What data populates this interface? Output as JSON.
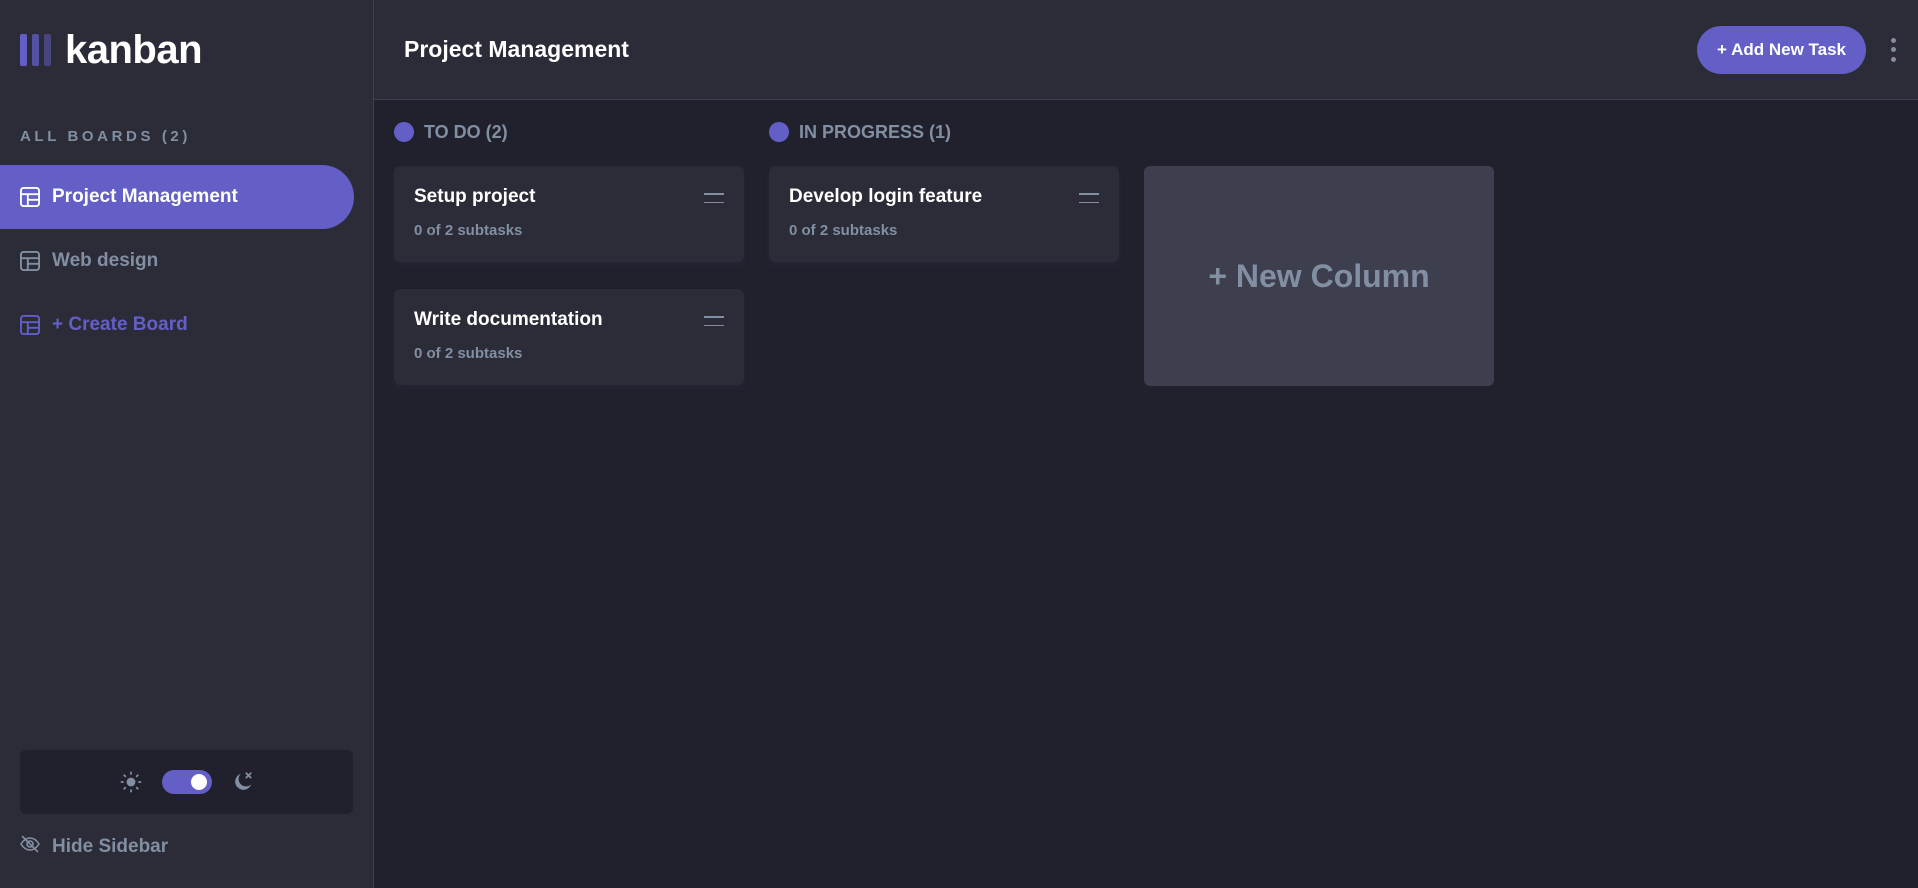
{
  "app": {
    "logo_text": "kanban",
    "accent_color": "#635fc7"
  },
  "sidebar": {
    "heading": "ALL BOARDS (2)",
    "boards": [
      {
        "label": "Project Management",
        "active": true,
        "icon": "board-icon"
      },
      {
        "label": "Web design",
        "active": false,
        "icon": "board-icon"
      }
    ],
    "create_label": "+ Create Board",
    "theme": {
      "light_icon": "sun-icon",
      "dark_icon": "moon-icon",
      "dark_mode": true
    },
    "hide_label": "Hide Sidebar"
  },
  "header": {
    "title": "Project Management",
    "add_task_label": "+ Add New Task",
    "menu_icon": "vertical-ellipsis-icon"
  },
  "columns": [
    {
      "name": "TO DO (2)",
      "tasks": [
        {
          "title": "Setup project",
          "subtasks": "0 of 2 subtasks"
        },
        {
          "title": "Write documentation",
          "subtasks": "0 of 2 subtasks"
        }
      ]
    },
    {
      "name": "IN PROGRESS (1)",
      "tasks": [
        {
          "title": "Develop login feature",
          "subtasks": "0 of 2 subtasks"
        }
      ]
    }
  ],
  "new_column_label": "+ New Column"
}
